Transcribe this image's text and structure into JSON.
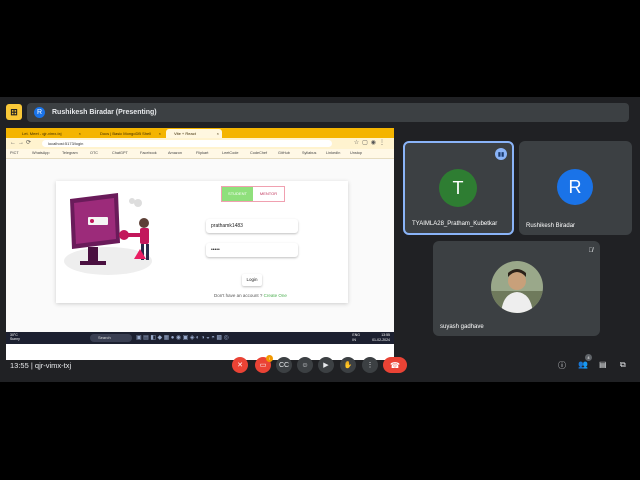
{
  "meet": {
    "logo_glyph": "⊞",
    "presenter_initial": "R",
    "presenter_banner": "Rushikesh Biradar (Presenting)",
    "time": "13:55",
    "separator": "|",
    "meeting_code": "qjr-vimx-txj",
    "reactions_badge": "!",
    "people_count": "4"
  },
  "browser": {
    "tabs": [
      {
        "label": "Let. Meet - qjr-vimx-txj"
      },
      {
        "label": "Docs | Basic MongoDB Shell"
      },
      {
        "label": "Vite + React"
      }
    ],
    "url": "localhost:5173/login",
    "bookmarks": [
      "PICT",
      "WhatsApp",
      "Telegram",
      "OTC",
      "ChatGPT",
      "Facebook",
      "Amazon",
      "Flipkart",
      "LeetCode",
      "CodeChef",
      "GitHub",
      "Syllabus",
      "LinkedIn",
      "Unstop"
    ]
  },
  "login": {
    "role_student": "STUDENT",
    "role_mentor": "MENTOR",
    "username_value": "prathamk1483",
    "password_value": "•••••",
    "login_button": "Login",
    "no_account_text": "Don't have an account ?",
    "create_link": "Create One"
  },
  "taskbar": {
    "weather_temp": "30°C",
    "weather_desc": "Sunny",
    "search_placeholder": "Search",
    "lang_line1": "ENG",
    "lang_line2": "IN",
    "clock_time": "13:55",
    "clock_date": "01-02-2024"
  },
  "participants": [
    {
      "initial": "T",
      "name": "TYAIMLA28_Pratham_Kubetkar",
      "color": "#2e7d32"
    },
    {
      "initial": "R",
      "name": "Rushikesh Biradar",
      "color": "#1a73e8"
    },
    {
      "name": "suyash gadhave"
    }
  ],
  "colors": {
    "meet_bg": "#202124",
    "tile_bg": "#3c4043",
    "active_border": "#8ab4f8",
    "end_call": "#ea4335",
    "browser_tabbar": "#f4b400",
    "student_active": "#8fe07c",
    "create_link": "#4caf50"
  }
}
